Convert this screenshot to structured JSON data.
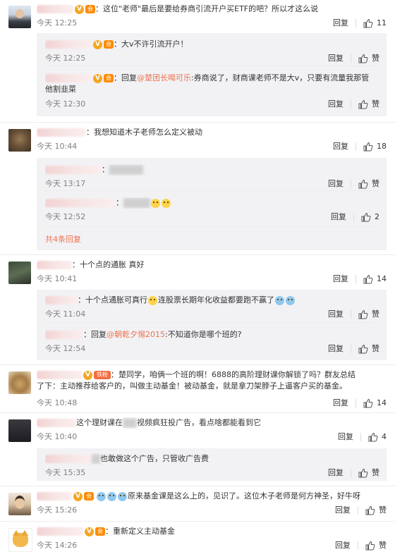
{
  "labels": {
    "reply": "回复",
    "like": "赞"
  },
  "threads": [
    {
      "text": "：这位\"老师\"最后是要给券商引流开户买ETF的吧？所以才这么说",
      "time": "今天 12:25",
      "likes": "11",
      "replies": [
        {
          "text": "：大v不许引流开户！",
          "time": "今天 12:25",
          "likes": "赞"
        },
        {
          "prefix": "：回复",
          "mention": "@楚团长喝可乐",
          "text": ":券商说了，财商课老师不是大v，只要有流量我那管",
          "text2": "他割韭菜",
          "time": "今天 12:30",
          "likes": "赞"
        }
      ]
    },
    {
      "text": "：我想知道木子老师怎么定义被动",
      "time": "今天 10:44",
      "likes": "18",
      "replies": [
        {
          "text": "：",
          "time": "今天 13:17",
          "likes": "赞"
        },
        {
          "text": "：",
          "time": "今天 12:52",
          "likes": "2"
        }
      ],
      "more": "共4条回复"
    },
    {
      "text": "：十个点的通胀 真好",
      "time": "今天 10:41",
      "likes": "14",
      "replies": [
        {
          "text": "：十个点通胀可真行",
          "text_b": "连股票长期年化收益都要跑不赢了",
          "time": "今天 11:04",
          "likes": "赞"
        },
        {
          "prefix": "：回复",
          "mention": "@朝乾夕惕2015",
          "text": ":不知道你是哪个班的?",
          "time": "今天 12:54",
          "likes": "赞"
        }
      ]
    },
    {
      "fan_badge": "铁粉",
      "text": "：楚同学，咱俩一个班的啊！6888的高阶理财课你解锁了吗？群友总结",
      "text2": "了下：主动推荐给客户的，叫做主动基金！被动基金，就是拿刀架脖子上逼客户买的基金。",
      "time": "今天 10:48",
      "likes": "14",
      "replies": []
    },
    {
      "text_pre": "这个理财课在",
      "text": "视频疯狂投广告，看点啥都能看到它",
      "time": "今天 10:40",
      "likes": "4",
      "replies": [
        {
          "text": "也敢做这个广告，只管收广告费",
          "time": "今天 15:35",
          "likes": "赞"
        }
      ]
    },
    {
      "text": "原来基金课是这么上的，见识了。这位木子老师是何方神圣，好牛呀",
      "time": "今天 15:26",
      "likes": "赞",
      "replies": []
    },
    {
      "text": "：重新定义主动基金",
      "time": "今天 14:26",
      "likes": "赞",
      "replies": []
    }
  ]
}
